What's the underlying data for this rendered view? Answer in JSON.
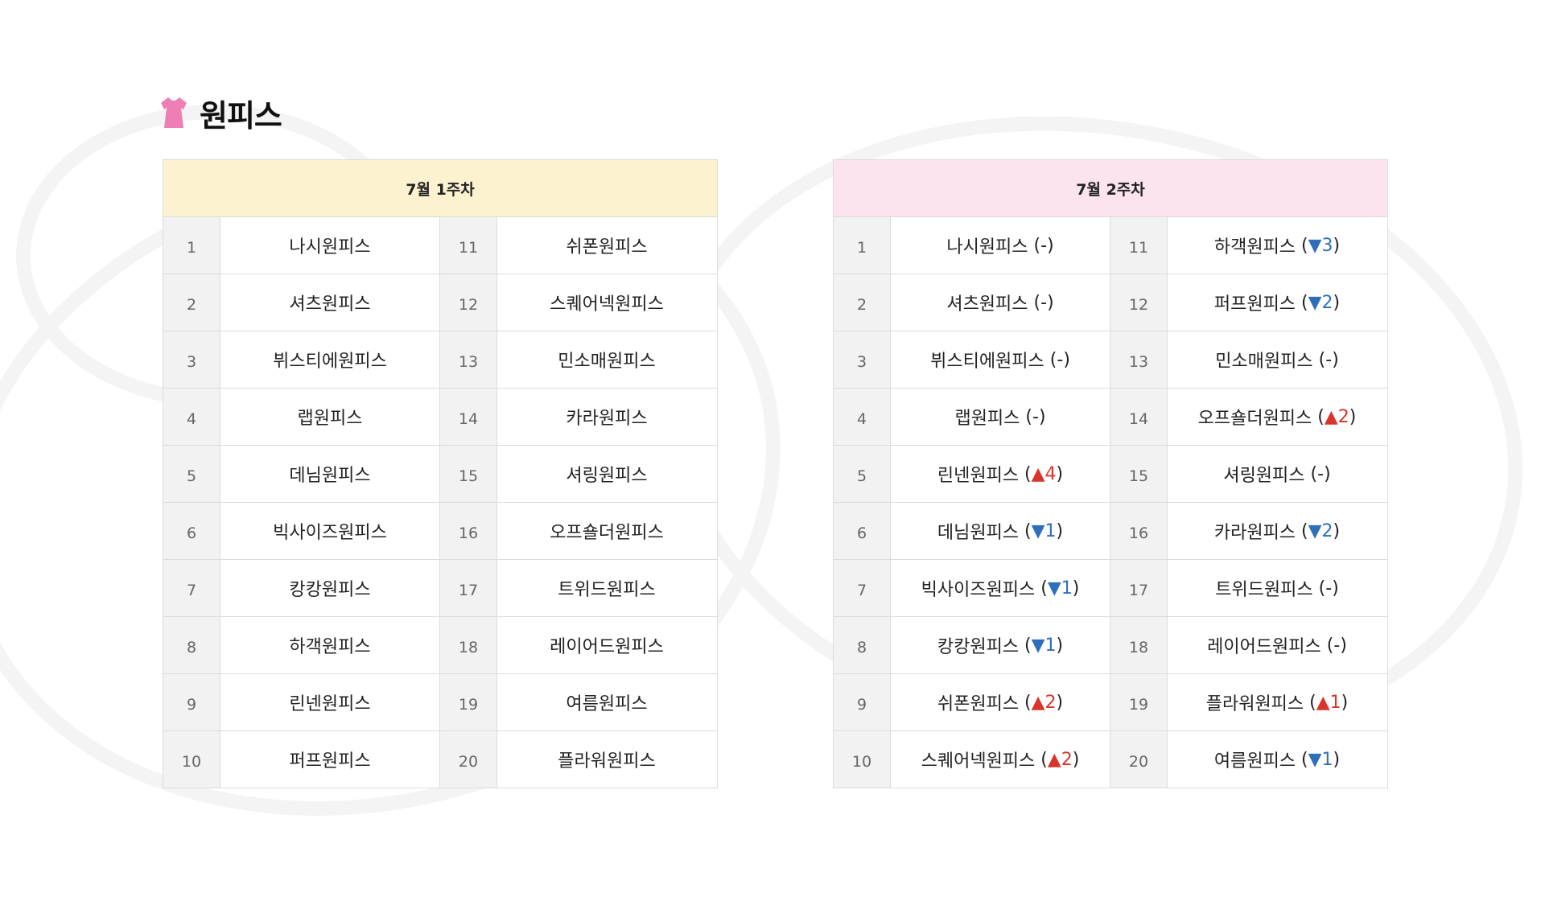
{
  "title": {
    "text": "원피스",
    "icon": "dress-icon",
    "icon_color": "#ee7fb4"
  },
  "week1": {
    "header": "7월 1주차",
    "rows": [
      {
        "r1": "1",
        "n1": "나시원피스",
        "r2": "11",
        "n2": "쉬폰원피스"
      },
      {
        "r1": "2",
        "n1": "셔츠원피스",
        "r2": "12",
        "n2": "스퀘어넥원피스"
      },
      {
        "r1": "3",
        "n1": "뷔스티에원피스",
        "r2": "13",
        "n2": "민소매원피스"
      },
      {
        "r1": "4",
        "n1": "랩원피스",
        "r2": "14",
        "n2": "카라원피스"
      },
      {
        "r1": "5",
        "n1": "데님원피스",
        "r2": "15",
        "n2": "셔링원피스"
      },
      {
        "r1": "6",
        "n1": "빅사이즈원피스",
        "r2": "16",
        "n2": "오프숄더원피스"
      },
      {
        "r1": "7",
        "n1": "캉캉원피스",
        "r2": "17",
        "n2": "트위드원피스"
      },
      {
        "r1": "8",
        "n1": "하객원피스",
        "r2": "18",
        "n2": "레이어드원피스"
      },
      {
        "r1": "9",
        "n1": "린넨원피스",
        "r2": "19",
        "n2": "여름원피스"
      },
      {
        "r1": "10",
        "n1": "퍼프원피스",
        "r2": "20",
        "n2": "플라워원피스"
      }
    ]
  },
  "week2": {
    "header": "7월 2주차",
    "rows": [
      {
        "r1": "1",
        "n1": "나시원피스",
        "c1": "-",
        "d1": "none",
        "r2": "11",
        "n2": "하객원피스",
        "c2": "▼3",
        "d2": "down"
      },
      {
        "r1": "2",
        "n1": "셔츠원피스",
        "c1": "-",
        "d1": "none",
        "r2": "12",
        "n2": "퍼프원피스",
        "c2": "▼2",
        "d2": "down"
      },
      {
        "r1": "3",
        "n1": "뷔스티에원피스",
        "c1": "-",
        "d1": "none",
        "r2": "13",
        "n2": "민소매원피스",
        "c2": "-",
        "d2": "none"
      },
      {
        "r1": "4",
        "n1": "랩원피스",
        "c1": "-",
        "d1": "none",
        "r2": "14",
        "n2": "오프숄더원피스",
        "c2": "▲2",
        "d2": "up"
      },
      {
        "r1": "5",
        "n1": "린넨원피스",
        "c1": "▲4",
        "d1": "up",
        "r2": "15",
        "n2": "셔링원피스",
        "c2": "-",
        "d2": "none"
      },
      {
        "r1": "6",
        "n1": "데님원피스",
        "c1": "▼1",
        "d1": "down",
        "r2": "16",
        "n2": "카라원피스",
        "c2": "▼2",
        "d2": "down"
      },
      {
        "r1": "7",
        "n1": "빅사이즈원피스",
        "c1": "▼1",
        "d1": "down",
        "r2": "17",
        "n2": "트위드원피스",
        "c2": "-",
        "d2": "none"
      },
      {
        "r1": "8",
        "n1": "캉캉원피스",
        "c1": "▼1",
        "d1": "down",
        "r2": "18",
        "n2": "레이어드원피스",
        "c2": "-",
        "d2": "none"
      },
      {
        "r1": "9",
        "n1": "쉬폰원피스",
        "c1": "▲2",
        "d1": "up",
        "r2": "19",
        "n2": "플라워원피스",
        "c2": "▲1",
        "d2": "up"
      },
      {
        "r1": "10",
        "n1": "스퀘어넥원피스",
        "c1": "▲2",
        "d1": "up",
        "r2": "20",
        "n2": "여름원피스",
        "c2": "▼1",
        "d2": "down"
      }
    ]
  },
  "colors": {
    "up": "#d9342b",
    "down": "#2f6fba",
    "week1_header_bg": "#fdf2cf",
    "week2_header_bg": "#fbe4ef"
  }
}
